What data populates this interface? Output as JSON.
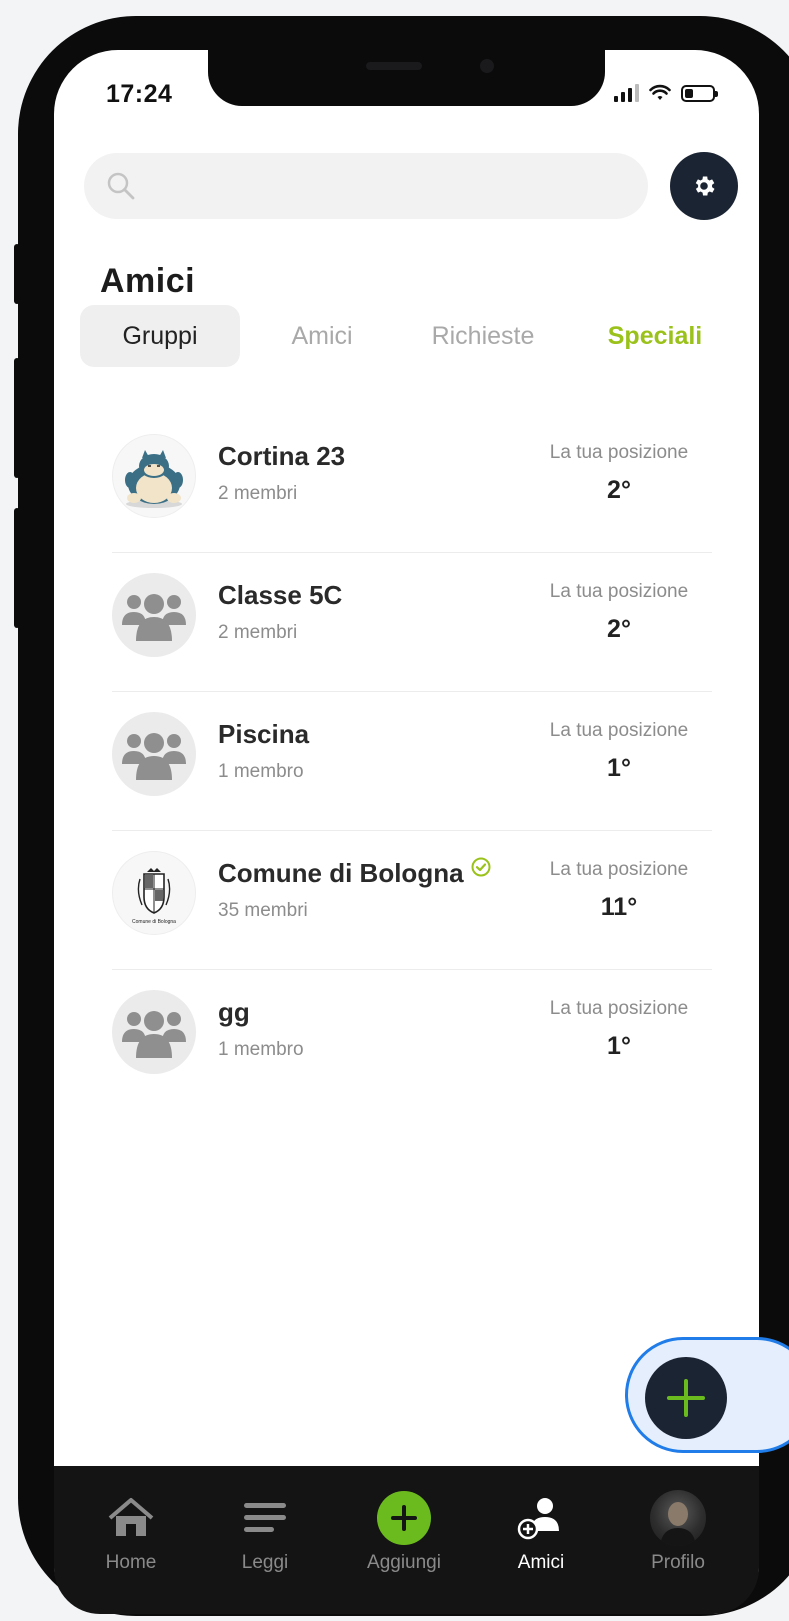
{
  "status_bar": {
    "time": "17:24"
  },
  "search": {
    "placeholder": ""
  },
  "page": {
    "title": "Amici"
  },
  "tabs": [
    {
      "label": "Gruppi",
      "active": true
    },
    {
      "label": "Amici",
      "active": false
    },
    {
      "label": "Richieste",
      "active": false
    },
    {
      "label": "Speciali",
      "active": false
    }
  ],
  "groups": [
    {
      "name": "Cortina 23",
      "members": "2 membri",
      "position_label": "La tua posizione",
      "position": "2°",
      "avatar": "snorlax-avatar"
    },
    {
      "name": "Classe 5C",
      "members": "2 membri",
      "position_label": "La tua posizione",
      "position": "2°",
      "avatar": "group-people-icon"
    },
    {
      "name": "Piscina",
      "members": "1 membro",
      "position_label": "La tua posizione",
      "position": "1°",
      "avatar": "group-people-icon"
    },
    {
      "name": "Comune di Bologna",
      "members": "35 membri",
      "position_label": "La tua posizione",
      "position": "11°",
      "avatar": "comune-bologna-crest",
      "verified": true,
      "crest_text": "Comune di Bologna"
    },
    {
      "name": "gg",
      "members": "1 membro",
      "position_label": "La tua posizione",
      "position": "1°",
      "avatar": "group-people-icon"
    }
  ],
  "bottom_nav": [
    {
      "label": "Home",
      "icon": "home-icon",
      "active": false
    },
    {
      "label": "Leggi",
      "icon": "menu-lines-icon",
      "active": false
    },
    {
      "label": "Aggiungi",
      "icon": "plus-circle-icon",
      "active": false
    },
    {
      "label": "Amici",
      "icon": "add-friend-icon",
      "active": true
    },
    {
      "label": "Profilo",
      "icon": "profile-avatar",
      "active": false
    }
  ],
  "colors": {
    "accent_green": "#9ac21a",
    "nav_green": "#6cbb1e",
    "dark_navy": "#1b2433",
    "highlight_blue": "#1f7ce8"
  }
}
